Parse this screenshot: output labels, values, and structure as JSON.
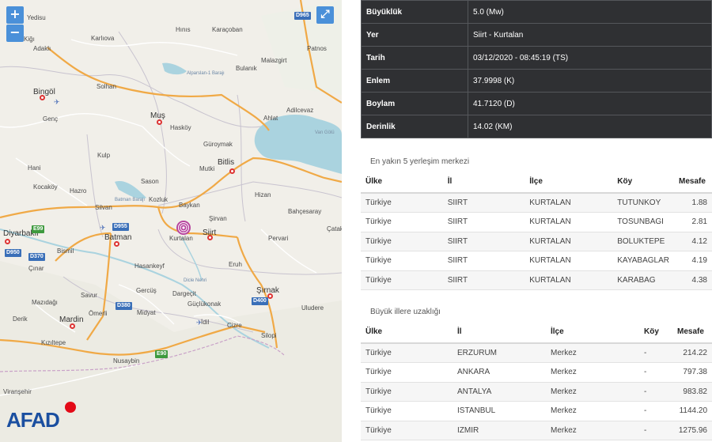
{
  "map": {
    "zoom_in": "+",
    "zoom_out": "−",
    "fullscreen": "⤢",
    "brand": "AFAD",
    "places": [
      {
        "t": "Yedisu",
        "big": false
      },
      {
        "t": "Hınıs",
        "big": false
      },
      {
        "t": "Karaçoban",
        "big": false
      },
      {
        "t": "Karlıova",
        "big": false
      },
      {
        "t": "Patnos",
        "big": false
      },
      {
        "t": "Kiğı",
        "big": false
      },
      {
        "t": "Adaklı",
        "big": false
      },
      {
        "t": "Malazgirt",
        "big": false
      },
      {
        "t": "Bulanık",
        "big": false
      },
      {
        "t": "Bingöl",
        "big": true
      },
      {
        "t": "Solhan",
        "big": false
      },
      {
        "t": "Adilcevaz",
        "big": false
      },
      {
        "t": "Ahlat",
        "big": false
      },
      {
        "t": "Genç",
        "big": false
      },
      {
        "t": "Muş",
        "big": true
      },
      {
        "t": "Hasköy",
        "big": false
      },
      {
        "t": "Güroymak",
        "big": false
      },
      {
        "t": "Kulp",
        "big": false
      },
      {
        "t": "Mutki",
        "big": false
      },
      {
        "t": "Bitlis",
        "big": true
      },
      {
        "t": "Hani",
        "big": false
      },
      {
        "t": "Sason",
        "big": false
      },
      {
        "t": "Kocaköy",
        "big": false
      },
      {
        "t": "Hazro",
        "big": false
      },
      {
        "t": "Kozluk",
        "big": false
      },
      {
        "t": "Hizan",
        "big": false
      },
      {
        "t": "Baykan",
        "big": false
      },
      {
        "t": "Silvan",
        "big": false
      },
      {
        "t": "Bahçesaray",
        "big": false
      },
      {
        "t": "Şirvan",
        "big": false
      },
      {
        "t": "Kurtalan",
        "big": false
      },
      {
        "t": "Siirt",
        "big": true
      },
      {
        "t": "Diyarbakır",
        "big": true
      },
      {
        "t": "Batman",
        "big": true
      },
      {
        "t": "Pervari",
        "big": false
      },
      {
        "t": "Çatak",
        "big": false
      },
      {
        "t": "Bismil",
        "big": false
      },
      {
        "t": "Eruh",
        "big": false
      },
      {
        "t": "Çınar",
        "big": false
      },
      {
        "t": "Hasankeyf",
        "big": false
      },
      {
        "t": "Şırnak",
        "big": true
      },
      {
        "t": "Savur",
        "big": false
      },
      {
        "t": "Gercüş",
        "big": false
      },
      {
        "t": "Dargeçit",
        "big": false
      },
      {
        "t": "Mazıdağı",
        "big": false
      },
      {
        "t": "Güçlükonak",
        "big": false
      },
      {
        "t": "Uludere",
        "big": false
      },
      {
        "t": "Ömerli",
        "big": false
      },
      {
        "t": "Midyat",
        "big": false
      },
      {
        "t": "Derik",
        "big": false
      },
      {
        "t": "Mardin",
        "big": true
      },
      {
        "t": "İdil",
        "big": false
      },
      {
        "t": "Cizre",
        "big": false
      },
      {
        "t": "Silopi",
        "big": false
      },
      {
        "t": "Kızıltepe",
        "big": false
      },
      {
        "t": "Nusaybin",
        "big": false
      },
      {
        "t": "Viranşehir",
        "big": false
      }
    ],
    "water_labels": [
      "Van Gölü",
      "Alparslan-1 Barajı",
      "Batman Barajı",
      "Dicle Nehri"
    ],
    "roads": [
      "D965",
      "D955",
      "E99",
      "D950",
      "D370",
      "D380",
      "D400",
      "E90"
    ]
  },
  "summary": [
    {
      "k": "Büyüklük",
      "v": "5.0 (Mw)"
    },
    {
      "k": "Yer",
      "v": "Siirt - Kurtalan"
    },
    {
      "k": "Tarih",
      "v": "03/12/2020 - 08:45:19 (TS)"
    },
    {
      "k": "Enlem",
      "v": "37.9998 (K)"
    },
    {
      "k": "Boylam",
      "v": "41.7120 (D)"
    },
    {
      "k": "Derinlik",
      "v": "14.02 (KM)"
    }
  ],
  "nearest": {
    "title": "En yakın 5 yerleşim merkezi",
    "headers": [
      "Ülke",
      "İl",
      "İlçe",
      "Köy",
      "Mesafe"
    ],
    "rows": [
      [
        "Türkiye",
        "SIIRT",
        "KURTALAN",
        "TUTUNKOY",
        "1.88"
      ],
      [
        "Türkiye",
        "SIIRT",
        "KURTALAN",
        "TOSUNBAGI",
        "2.81"
      ],
      [
        "Türkiye",
        "SIIRT",
        "KURTALAN",
        "BOLUKTEPE",
        "4.12"
      ],
      [
        "Türkiye",
        "SIIRT",
        "KURTALAN",
        "KAYABAGLAR",
        "4.19"
      ],
      [
        "Türkiye",
        "SIIRT",
        "KURTALAN",
        "KARABAG",
        "4.38"
      ]
    ]
  },
  "cities": {
    "title": "Büyük illere uzaklığı",
    "headers": [
      "Ülke",
      "İl",
      "İlçe",
      "Köy",
      "Mesafe"
    ],
    "rows": [
      [
        "Türkiye",
        "ERZURUM",
        "Merkez",
        "-",
        "214.22"
      ],
      [
        "Türkiye",
        "ANKARA",
        "Merkez",
        "-",
        "797.38"
      ],
      [
        "Türkiye",
        "ANTALYA",
        "Merkez",
        "-",
        "983.82"
      ],
      [
        "Türkiye",
        "ISTANBUL",
        "Merkez",
        "-",
        "1144.20"
      ],
      [
        "Türkiye",
        "IZMIR",
        "Merkez",
        "-",
        "1275.96"
      ]
    ]
  }
}
